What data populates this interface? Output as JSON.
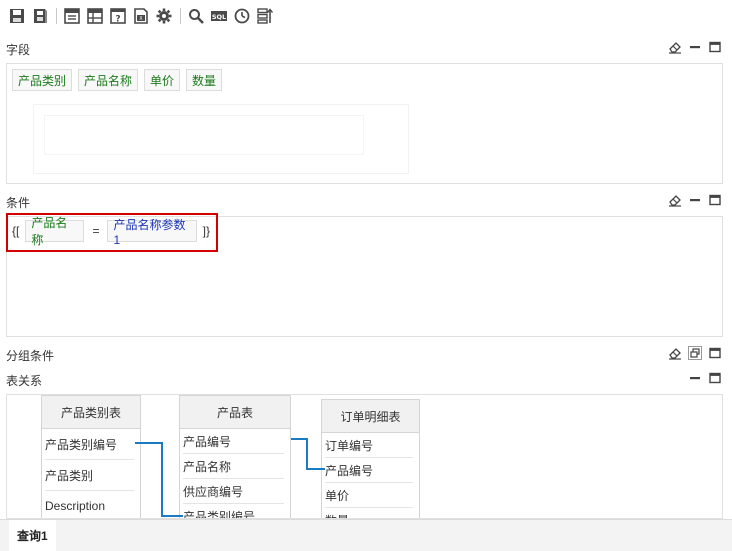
{
  "toolbar": {
    "items": [
      "save-icon",
      "save-as-icon",
      "field-layout-icon",
      "table-layout-icon",
      "parameter-icon",
      "export-icon",
      "settings-gear-icon",
      "search-icon",
      "sql-icon",
      "history-clock-icon",
      "sort-icon"
    ],
    "sql_label": "SQL"
  },
  "sections": {
    "fields": {
      "label": "字段"
    },
    "conditions": {
      "label": "条件"
    },
    "group": {
      "label": "分组条件"
    },
    "relations": {
      "label": "表关系"
    }
  },
  "fields": [
    "产品类别",
    "产品名称",
    "单价",
    "数量"
  ],
  "condition": {
    "open": "{[",
    "field": "产品名称",
    "operator": "=",
    "param": "产品名称参数1",
    "close": "]}"
  },
  "tables": [
    {
      "name": "产品类别表",
      "columns": [
        "产品类别编号",
        "产品类别",
        "Description"
      ]
    },
    {
      "name": "产品表",
      "columns": [
        "产品编号",
        "产品名称",
        "供应商编号",
        "产品类别编号"
      ]
    },
    {
      "name": "订单明细表",
      "columns": [
        "订单编号",
        "产品编号",
        "单价",
        "数量"
      ]
    }
  ],
  "bottom": {
    "tab": "查询1"
  },
  "colors": {
    "accent_link": "#1b7ac4",
    "highlight": "#d40000",
    "field_text": "#1a7a1a",
    "param_text": "#1a35b8"
  }
}
